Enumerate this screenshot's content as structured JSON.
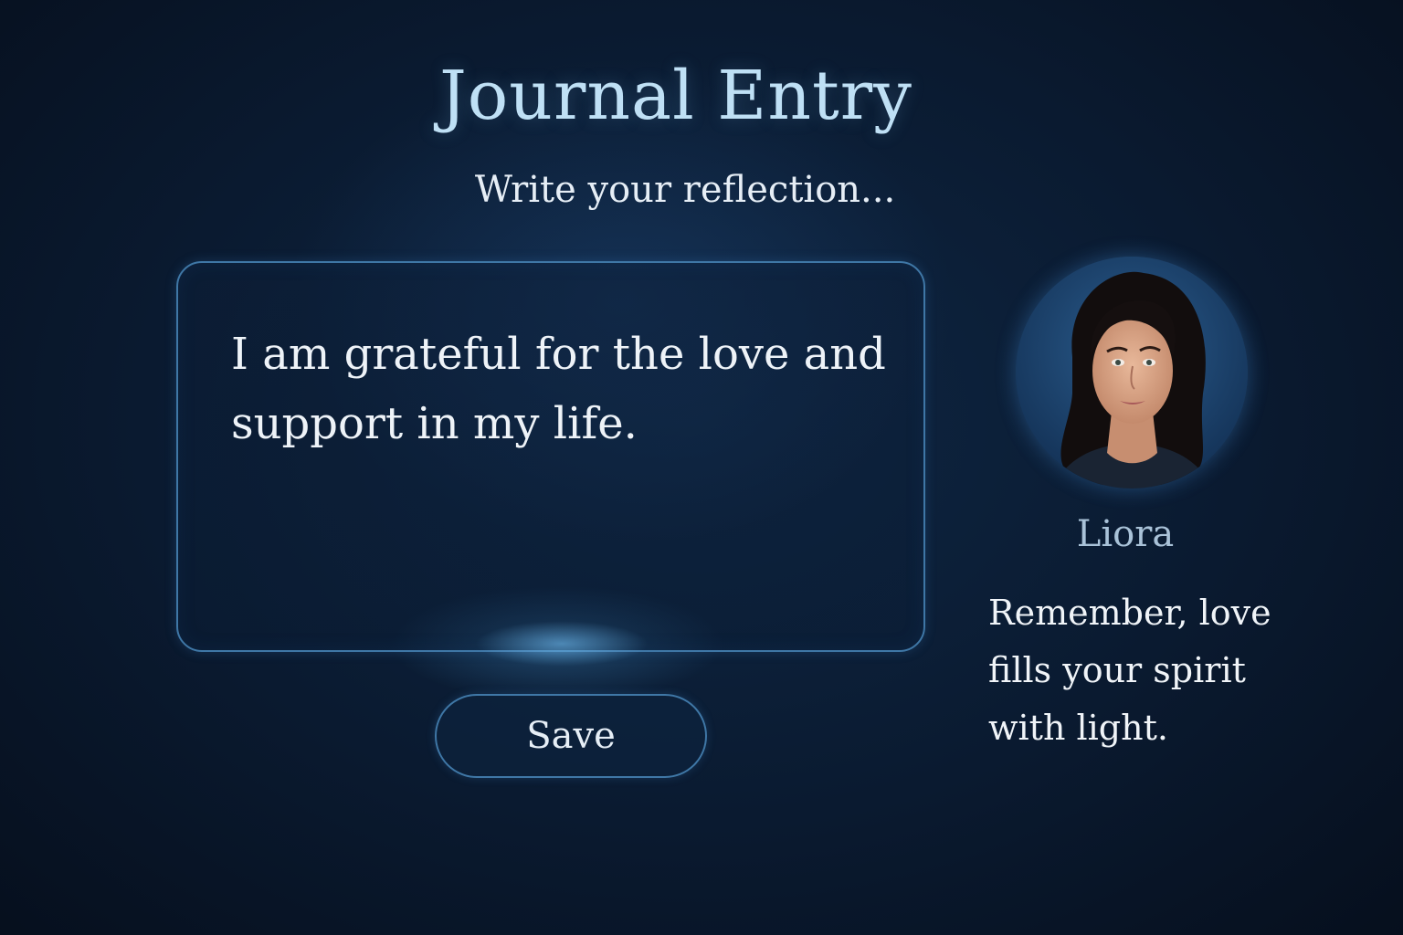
{
  "header": {
    "title": "Journal Entry",
    "subtitle": "Write your reflection..."
  },
  "entry": {
    "text": "I am grateful for the love and support in my life."
  },
  "actions": {
    "save_label": "Save"
  },
  "companion": {
    "name": "Liora",
    "message": "Remember, love fills your spirit with light."
  },
  "colors": {
    "background": "#0a1a30",
    "accent_border": "#3f77a6",
    "title": "#bfe0f5",
    "name": "#a9c2d8"
  }
}
